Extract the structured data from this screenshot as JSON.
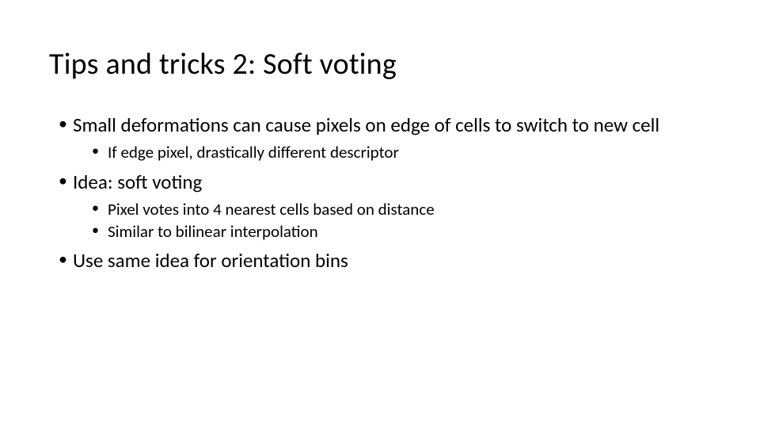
{
  "title": "Tips and tricks 2: Soft voting",
  "bullets": {
    "b1": "Small deformations can cause pixels on edge of cells to switch to new cell",
    "b1_1": "If edge pixel, drastically different descriptor",
    "b2": "Idea: soft voting",
    "b2_1": "Pixel votes into 4 nearest cells based on distance",
    "b2_2": "Similar to bilinear interpolation",
    "b3": "Use same idea for orientation bins"
  }
}
